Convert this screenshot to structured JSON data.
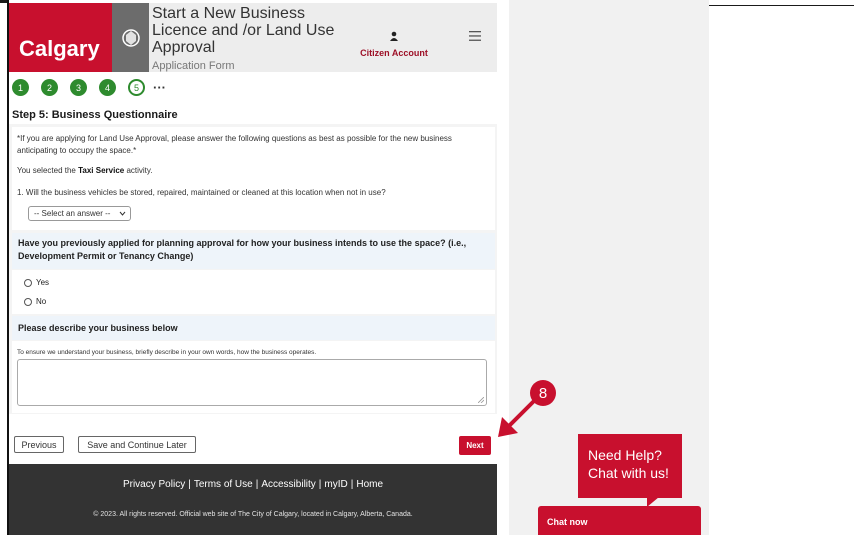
{
  "header": {
    "brand": "Calgary",
    "app_title": "Start a New Business Licence and /or Land Use Approval",
    "app_subtitle": "Application Form",
    "account_label": "Citizen Account"
  },
  "stepper": {
    "steps": [
      "1",
      "2",
      "3",
      "4",
      "5"
    ],
    "current": "5",
    "more": "···"
  },
  "step_title": "Step 5: Business Questionnaire",
  "questionnaire": {
    "note": "*If you are applying for Land Use Approval, please answer the following questions as best as possible for the new business anticipating to occupy the space.*",
    "selected_prefix": "You selected the",
    "selected_activity": "Taxi Service",
    "selected_suffix": "activity.",
    "question1": "1. Will the business vehicles be stored, repaired, maintained or cleaned at this location when not in use?",
    "select_value": "-- Select an answer --"
  },
  "planning": {
    "question": "Have you previously applied for planning approval for how your business intends to use the space? (i.e., Development Permit or Tenancy Change)",
    "options": [
      "Yes",
      "No"
    ]
  },
  "describe": {
    "heading": "Please describe your business below",
    "hint": "To ensure we understand your business, briefly describe in your own words, how the business operates."
  },
  "buttons": {
    "previous": "Previous",
    "save_later": "Save and Continue Later",
    "next": "Next"
  },
  "footer": {
    "links": [
      "Privacy Policy",
      "Terms of Use",
      "Accessibility",
      "myID",
      "Home"
    ],
    "copyright": "© 2023. All rights reserved. Official web site of The City of Calgary, located in Calgary, Alberta, Canada."
  },
  "annotation": {
    "number": "8"
  },
  "chat": {
    "help_line1": "Need Help?",
    "help_line2": "Chat with us!",
    "chat_now": "Chat now"
  },
  "colors": {
    "brand_red": "#c8102e",
    "step_green": "#2e8b2e",
    "footer_bg": "#333333"
  }
}
